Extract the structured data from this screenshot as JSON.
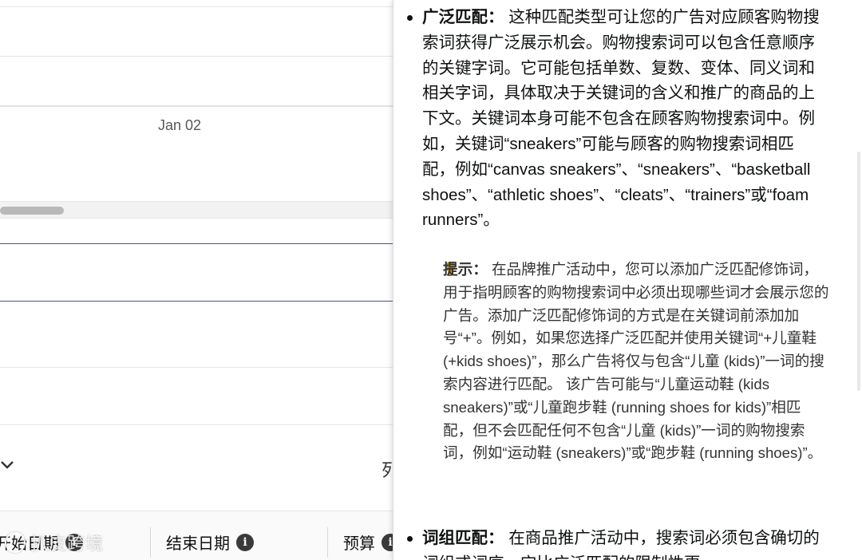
{
  "left": {
    "date_label": "Jan 02",
    "chevron": "chevron-down-icon",
    "column_cut_text": "列",
    "headers": [
      {
        "label": "开始日期",
        "icon": "info-icon"
      },
      {
        "label": "结束日期",
        "icon": "info-icon"
      },
      {
        "label": "预算",
        "icon": "info-icon"
      }
    ],
    "info_glyph": "i",
    "watermark": "扒皮跨境"
  },
  "panel": {
    "broad": {
      "term": "广泛匹配：",
      "text": " 这种匹配类型可让您的广告对应顾客购物搜索词获得广泛展示机会。购物搜索词可以包含任意顺序的关键字词。它可能包括单数、复数、变体、同义词和相关字词，具体取决于关键词的含义和推广的商品的上下文。关键词本身可能不包含在顾客购物搜索词中。例如，关键词“sneakers”可能与顾客的购物搜索词相匹配，例如“canvas sneakers”、“sneakers”、“basketball shoes”、“athletic shoes”、“cleats”、“trainers”或“foam runners”。"
    },
    "tip": {
      "icon": "lightbulb-icon",
      "term": "提示：",
      "text": " 在品牌推广活动中，您可以添加广泛匹配修饰词，用于指明顾客的购物搜索词中必须出现哪些词才会展示您的广告。添加广泛匹配修饰词的方式是在关键词前添加加号“+”。例如，如果您选择广泛匹配并使用关键词“+儿童鞋 (+kids shoes)”，那么广告将仅与包含“儿童 (kids)”一词的搜索内容进行匹配。 该广告可能与“儿童运动鞋 (kids sneakers)”或“儿童跑步鞋 (running shoes for kids)”相匹配，但不会匹配任何不包含“儿童 (kids)”一词的购物搜索词，例如“运动鞋 (sneakers)”或“跑步鞋 (running shoes)”。"
    },
    "phrase": {
      "term": "词组匹配：",
      "text": " 在商品推广活动中，搜索词必须包含确切的词组或词序，它比广泛匹配的限制性更"
    }
  },
  "colors": {
    "accent_line": "#4153a8",
    "bulb": "#c39a1b"
  }
}
